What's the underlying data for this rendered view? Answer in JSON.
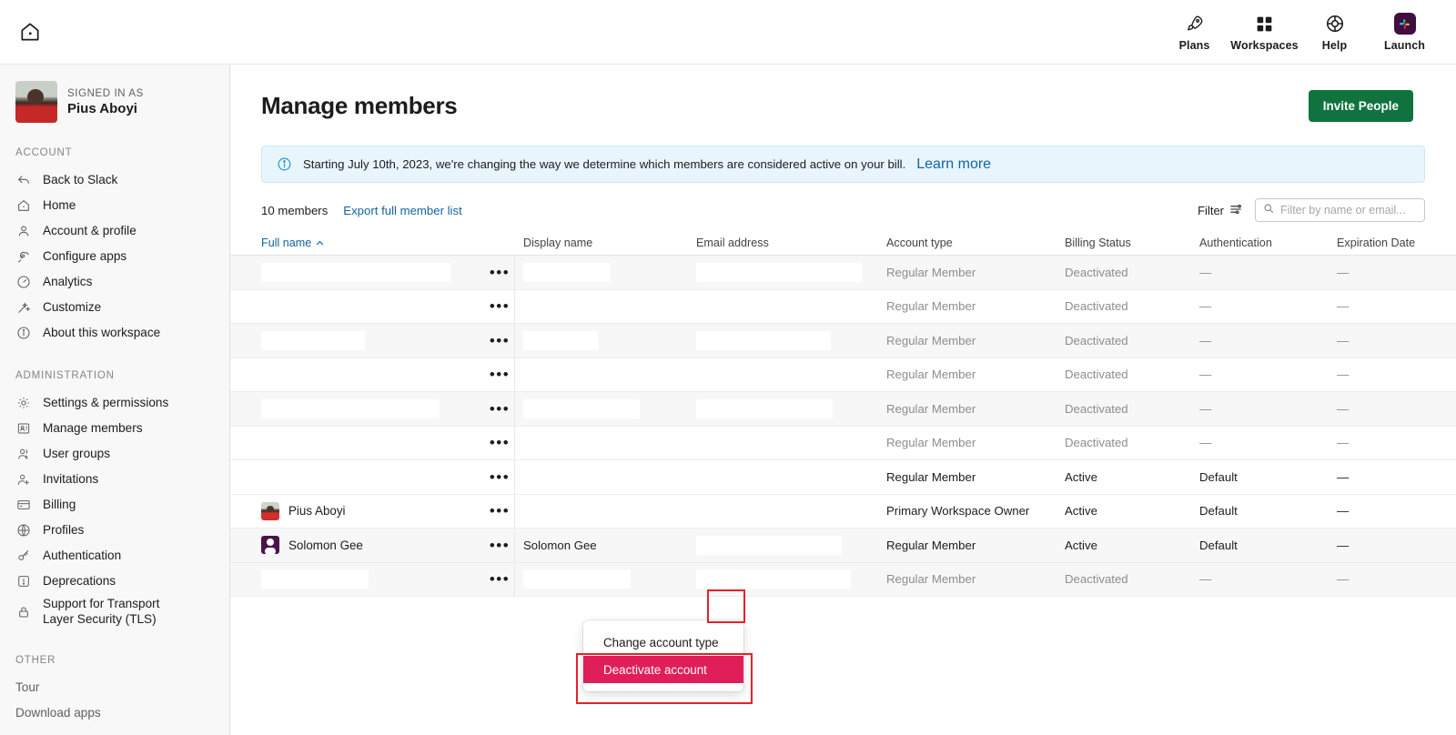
{
  "topbar": {
    "home_icon": "home-icon",
    "nav": [
      {
        "label": "Plans",
        "icon": "rocket-icon"
      },
      {
        "label": "Workspaces",
        "icon": "grid-icon"
      },
      {
        "label": "Help",
        "icon": "lifebuoy-icon"
      },
      {
        "label": "Launch",
        "icon": "slack-logo-icon"
      }
    ]
  },
  "sidebar": {
    "signed_in_label": "SIGNED IN AS",
    "signed_in_name": "Pius Aboyi",
    "sections": [
      {
        "title": "ACCOUNT",
        "items": [
          {
            "label": "Back to Slack",
            "icon": "back-arrow-icon"
          },
          {
            "label": "Home",
            "icon": "home-icon"
          },
          {
            "label": "Account & profile",
            "icon": "person-icon"
          },
          {
            "label": "Configure apps",
            "icon": "plug-icon"
          },
          {
            "label": "Analytics",
            "icon": "gauge-icon"
          },
          {
            "label": "Customize",
            "icon": "magic-wand-icon"
          },
          {
            "label": "About this workspace",
            "icon": "info-icon"
          }
        ]
      },
      {
        "title": "ADMINISTRATION",
        "items": [
          {
            "label": "Settings & permissions",
            "icon": "gear-icon"
          },
          {
            "label": "Manage members",
            "icon": "id-card-icon"
          },
          {
            "label": "User groups",
            "icon": "people-icon"
          },
          {
            "label": "Invitations",
            "icon": "person-add-icon"
          },
          {
            "label": "Billing",
            "icon": "credit-card-icon"
          },
          {
            "label": "Profiles",
            "icon": "globe-icon"
          },
          {
            "label": "Authentication",
            "icon": "key-icon"
          },
          {
            "label": "Deprecations",
            "icon": "alert-icon"
          },
          {
            "label": "Support for Transport Layer Security (TLS)",
            "icon": "lock-icon"
          }
        ]
      },
      {
        "title": "OTHER",
        "items": [
          {
            "label": "Tour",
            "icon": ""
          },
          {
            "label": "Download apps",
            "icon": ""
          }
        ]
      }
    ]
  },
  "page": {
    "title": "Manage members",
    "invite_button": "Invite People"
  },
  "banner": {
    "icon": "info-circle-icon",
    "text": "Starting July 10th, 2023, we're changing the way we determine which members are considered active on your bill.",
    "link": "Learn more"
  },
  "toolbar": {
    "member_count": "10 members",
    "export_link": "Export full member list",
    "filter_label": "Filter",
    "filter_icon": "sliders-icon",
    "search_icon": "search-icon",
    "search_placeholder": "Filter by name or email...",
    "search_value": ""
  },
  "table": {
    "columns": [
      {
        "label": "Full name",
        "sorted": true,
        "sort_dir": "asc"
      },
      {
        "label": "Display name",
        "sorted": false
      },
      {
        "label": "Email address",
        "sorted": false
      },
      {
        "label": "Account type",
        "sorted": false
      },
      {
        "label": "Billing Status",
        "sorted": false
      },
      {
        "label": "Authentication",
        "sorted": false
      },
      {
        "label": "Expiration Date",
        "sorted": false
      }
    ],
    "menu_glyph": "•••",
    "rows": [
      {
        "name": "",
        "redacted_name": true,
        "name_w": 208,
        "avatar": "",
        "display": "",
        "redacted_display": true,
        "display_w": 96,
        "email": "",
        "redacted_email": true,
        "email_w": 182,
        "type": "Regular Member",
        "billing": "Deactivated",
        "auth": "—",
        "expiry": "—",
        "dim": true,
        "zebra": true
      },
      {
        "name": "",
        "redacted_name": true,
        "name_w": 166,
        "avatar": "",
        "display": "",
        "redacted_display": true,
        "display_w": 80,
        "email": "",
        "redacted_email": true,
        "email_w": 184,
        "type": "Regular Member",
        "billing": "Deactivated",
        "auth": "—",
        "expiry": "—",
        "dim": true,
        "zebra": false
      },
      {
        "name": "",
        "redacted_name": true,
        "name_w": 114,
        "avatar": "",
        "display": "",
        "redacted_display": true,
        "display_w": 82,
        "email": "",
        "redacted_email": true,
        "email_w": 148,
        "type": "Regular Member",
        "billing": "Deactivated",
        "auth": "—",
        "expiry": "—",
        "dim": true,
        "zebra": true
      },
      {
        "name": "",
        "redacted_name": true,
        "name_w": 114,
        "avatar": "",
        "display": "",
        "redacted_display": false,
        "display_w": 0,
        "email": "",
        "redacted_email": true,
        "email_w": 128,
        "type": "Regular Member",
        "billing": "Deactivated",
        "auth": "—",
        "expiry": "—",
        "dim": true,
        "zebra": false
      },
      {
        "name": "",
        "redacted_name": true,
        "name_w": 196,
        "avatar": "",
        "display": "",
        "redacted_display": true,
        "display_w": 128,
        "email": "",
        "redacted_email": true,
        "email_w": 150,
        "type": "Regular Member",
        "billing": "Deactivated",
        "auth": "—",
        "expiry": "—",
        "dim": true,
        "zebra": true
      },
      {
        "name": "",
        "redacted_name": true,
        "name_w": 154,
        "avatar": "",
        "display": "",
        "redacted_display": false,
        "display_w": 0,
        "email": "",
        "redacted_email": true,
        "email_w": 126,
        "type": "Regular Member",
        "billing": "Deactivated",
        "auth": "—",
        "expiry": "—",
        "dim": true,
        "zebra": false
      },
      {
        "name": "",
        "redacted_name": false,
        "name_w": 0,
        "avatar": "",
        "display": "",
        "redacted_display": false,
        "display_w": 0,
        "email": "",
        "redacted_email": false,
        "email_w": 0,
        "type": "Regular Member",
        "billing": "Active",
        "auth": "Default",
        "expiry": "—",
        "dim": false,
        "zebra": false
      },
      {
        "name": "Pius Aboyi",
        "redacted_name": false,
        "name_w": 0,
        "avatar": "avatar-pius",
        "display": "",
        "redacted_display": false,
        "display_w": 0,
        "email": "",
        "redacted_email": false,
        "email_w": 0,
        "type": "Primary Workspace Owner",
        "billing": "Active",
        "auth": "Default",
        "expiry": "—",
        "dim": false,
        "zebra": false
      },
      {
        "name": "Solomon Gee",
        "redacted_name": false,
        "name_w": 0,
        "avatar": "avatar-solomon",
        "display": "Solomon Gee",
        "redacted_display": false,
        "display_w": 0,
        "email": "",
        "redacted_email": true,
        "email_w": 160,
        "type": "Regular Member",
        "billing": "Active",
        "auth": "Default",
        "expiry": "—",
        "dim": false,
        "zebra": true
      },
      {
        "name": "",
        "redacted_name": true,
        "name_w": 118,
        "avatar": "",
        "display": "",
        "redacted_display": true,
        "display_w": 118,
        "email": "",
        "redacted_email": true,
        "email_w": 170,
        "type": "Regular Member",
        "billing": "Deactivated",
        "auth": "—",
        "expiry": "—",
        "dim": true,
        "zebra": true
      }
    ]
  },
  "context_menu": {
    "items": [
      {
        "label": "Change account type",
        "danger": false
      },
      {
        "label": "Deactivate account",
        "danger": true
      }
    ]
  },
  "colors": {
    "accent_green": "#10733f",
    "danger_pink": "#e01e5a",
    "link_blue": "#1264a3",
    "annotation_red": "#e8202a",
    "banner_bg": "#e8f5fd",
    "slack_purple": "#4a154b"
  }
}
